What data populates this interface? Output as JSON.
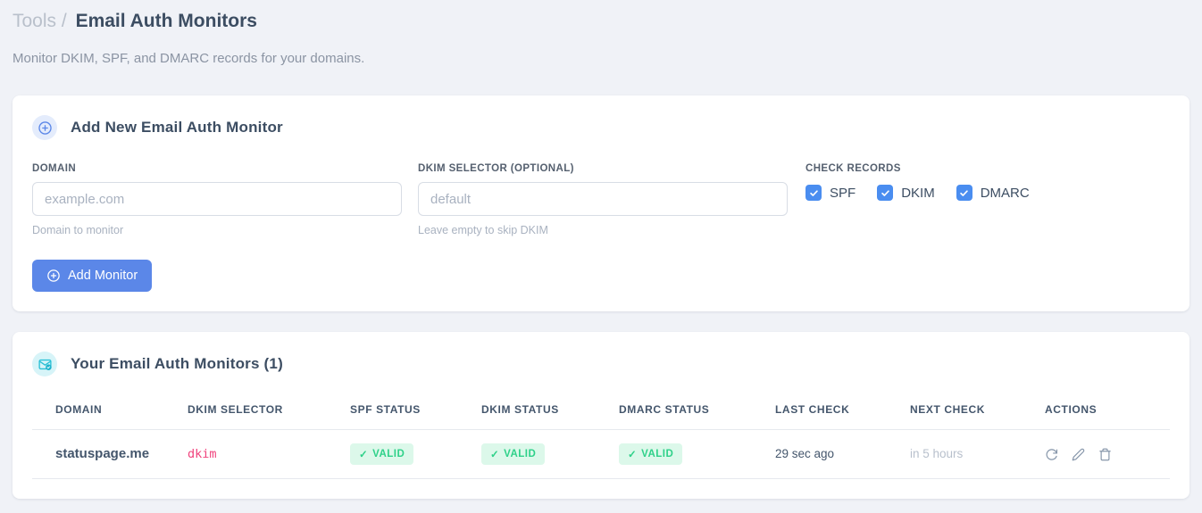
{
  "page": {
    "breadcrumb": {
      "parent": "Tools",
      "separator": "/",
      "current": "Email Auth Monitors"
    },
    "subtitle": "Monitor DKIM, SPF, and DMARC records for your domains."
  },
  "add_monitor_card": {
    "title": "Add New Email Auth Monitor",
    "fields": {
      "domain": {
        "label": "DOMAIN",
        "value": "",
        "placeholder": "example.com",
        "hint": "Domain to monitor"
      },
      "dkim_selector": {
        "label": "DKIM SELECTOR (OPTIONAL)",
        "value": "",
        "placeholder": "default",
        "hint": "Leave empty to skip DKIM"
      }
    },
    "check_records": {
      "label": "CHECK RECORDS",
      "check_glyph": "✓",
      "options": [
        {
          "label": "SPF",
          "checked": true
        },
        {
          "label": "DKIM",
          "checked": true
        },
        {
          "label": "DMARC",
          "checked": true
        }
      ]
    },
    "submit_label": "Add Monitor"
  },
  "monitors_card": {
    "title": "Your Email Auth Monitors (1)",
    "valid_check_glyph": "✓",
    "table": {
      "headers": [
        "DOMAIN",
        "DKIM SELECTOR",
        "SPF STATUS",
        "DKIM STATUS",
        "DMARC STATUS",
        "LAST CHECK",
        "NEXT CHECK",
        "ACTIONS"
      ],
      "rows": [
        {
          "domain": "statuspage.me",
          "dkim_selector": "dkim",
          "spf_status": "VALID",
          "dkim_status": "VALID",
          "dmarc_status": "VALID",
          "last_check": "29 sec ago",
          "next_check": "in 5 hours"
        }
      ]
    }
  },
  "icons": {
    "card1_icon": "plus-circle-icon",
    "card2_icon": "envelope-check-icon",
    "row_actions": [
      "refresh-icon",
      "edit-pencil-icon",
      "trash-icon"
    ]
  },
  "colors": {
    "page_bg": "#f0f2f7",
    "primary_blue": "#5b87e8",
    "checkbox_blue": "#4a8df0",
    "icon_blue_bg": "#e4ecfc",
    "icon_teal": "#2ac0d6",
    "icon_teal_bg": "#d7f4f8",
    "badge_green_bg": "#dcf8ea",
    "badge_green_text": "#2ed189",
    "code_pink": "#f0427c"
  }
}
